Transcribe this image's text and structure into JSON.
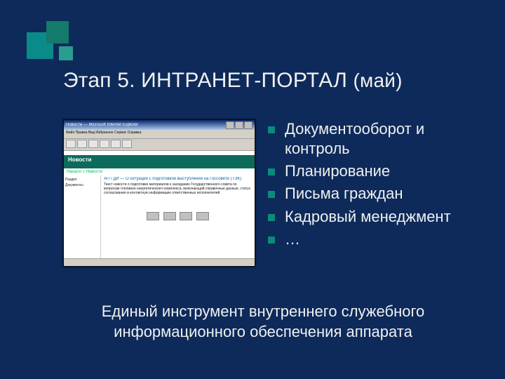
{
  "decor": {
    "squares": 3
  },
  "title": {
    "prefix": "Этап 5. ИНТРАНЕТ-ПОРТАЛ ",
    "month": "(май)"
  },
  "bullets": [
    "Документооборот и контроль",
    "Планирование",
    "Письма граждан",
    "Кадровый менеджмент",
    "…"
  ],
  "footer": "Единый инструмент внутреннего служебного информационного обеспечения аппарата",
  "screenshot": {
    "window_title": "Новости — Microsoft Internet Explorer",
    "menubar": "Файл  Правка  Вид  Избранное  Сервис  Справка",
    "section_header": "Новости",
    "breadcrumb": "Начало » Новости",
    "sidebar_items": [
      "Раздел",
      "Документы"
    ],
    "article_title": "АП / ДИ — О ситуации с подготовкой выступления на Госсовете (ТЭК)",
    "article_body": "Текст новости о подготовке материалов к заседанию Государственного совета по вопросам топливно-энергетического комплекса, включающий справочные данные, статус согласования и контактную информацию ответственных исполнителей.",
    "pager_buttons": 4
  }
}
